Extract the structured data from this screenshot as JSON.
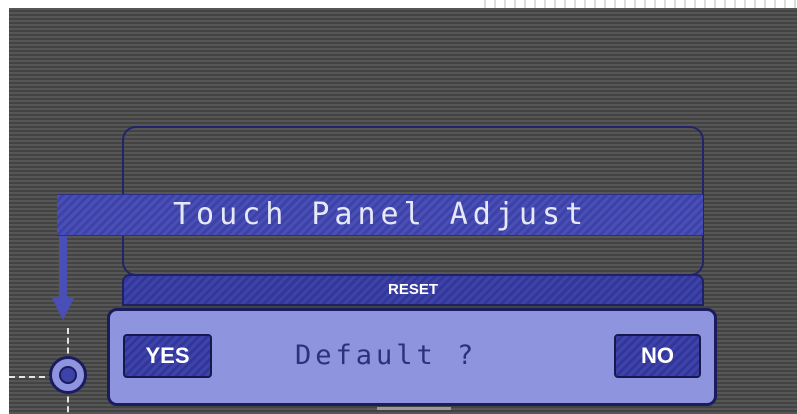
{
  "panel": {
    "title": "Touch Panel Adjust",
    "reset_label": "RESET"
  },
  "dialog": {
    "question": "Default ?",
    "yes_label": "YES",
    "no_label": "NO"
  },
  "colors": {
    "screen_bg": "#4d4d4d",
    "bar_blue": "#4a4fb8",
    "dialog_bg": "#8e94de",
    "border_dark": "#1a1c5e",
    "text_light": "#e6e9f5"
  },
  "icons": {
    "calibration_target": "crosshair-target-icon",
    "pointer_arrow": "arrow-down-icon"
  }
}
